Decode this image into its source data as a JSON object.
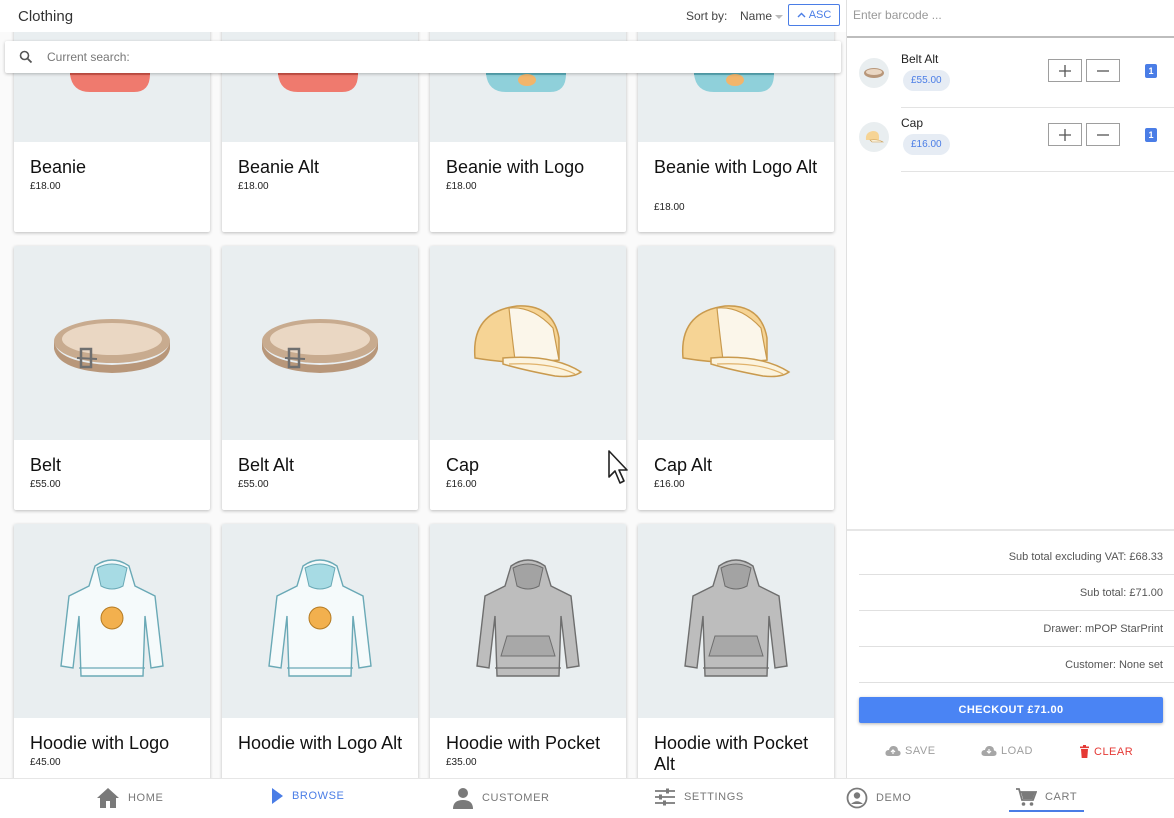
{
  "header": {
    "title": "Clothing",
    "sort_label": "Sort by:",
    "sort_field": "Name",
    "sort_dir": "ASC"
  },
  "search": {
    "placeholder": "Current search:"
  },
  "products": [
    {
      "name": "Beanie",
      "price": "£18.00"
    },
    {
      "name": "Beanie Alt",
      "price": "£18.00"
    },
    {
      "name": "Beanie with Logo",
      "price": "£18.00"
    },
    {
      "name": "Beanie with Logo Alt",
      "price": "£18.00"
    },
    {
      "name": "Belt",
      "price": "£55.00"
    },
    {
      "name": "Belt Alt",
      "price": "£55.00"
    },
    {
      "name": "Cap",
      "price": "£16.00"
    },
    {
      "name": "Cap Alt",
      "price": "£16.00"
    },
    {
      "name": "Hoodie with Logo",
      "price": "£45.00"
    },
    {
      "name": "Hoodie with Logo Alt",
      "price": ""
    },
    {
      "name": "Hoodie with Pocket",
      "price": "£35.00"
    },
    {
      "name": "Hoodie with Pocket Alt",
      "price": ""
    }
  ],
  "cart": {
    "barcode_placeholder": "Enter barcode ...",
    "items": [
      {
        "name": "Belt Alt",
        "price": "£55.00",
        "qty": "1"
      },
      {
        "name": "Cap",
        "price": "£16.00",
        "qty": "1"
      }
    ],
    "subtotal_ex_vat": "Sub total excluding VAT: £68.33",
    "subtotal": "Sub total: £71.00",
    "drawer": "Drawer: mPOP StarPrint",
    "customer": "Customer: None set",
    "checkout_label": "CHECKOUT £71.00",
    "save_label": "SAVE",
    "load_label": "LOAD",
    "clear_label": "CLEAR"
  },
  "nav": [
    {
      "label": "HOME",
      "icon": "home-icon"
    },
    {
      "label": "BROWSE",
      "icon": "play-icon",
      "active": true
    },
    {
      "label": "CUSTOMER",
      "icon": "person-icon"
    },
    {
      "label": "SETTINGS",
      "icon": "sliders-icon"
    },
    {
      "label": "DEMO",
      "icon": "account-circle-icon"
    },
    {
      "label": "CART",
      "icon": "cart-icon"
    }
  ],
  "colors": {
    "accent": "#4a7de6",
    "checkout": "#4a84f4",
    "danger": "#e53935",
    "image_bg": "#e9eef0"
  }
}
